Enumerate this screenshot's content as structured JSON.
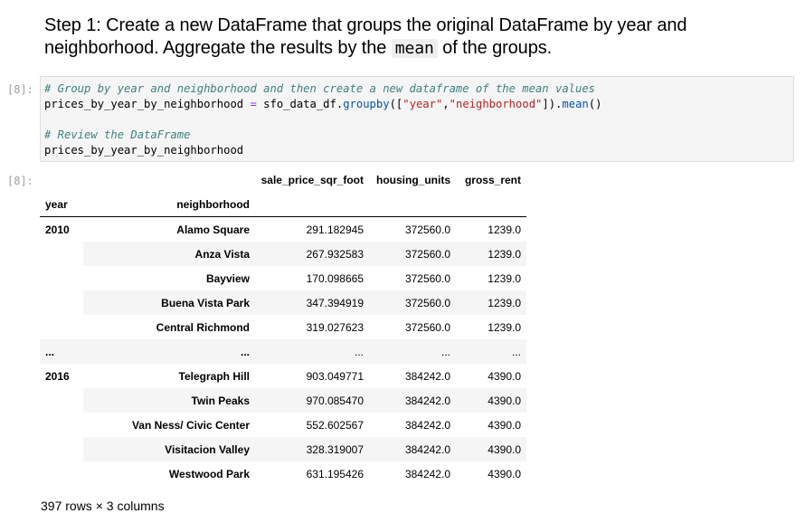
{
  "markdown": {
    "heading_part1": "Step 1: Create a new DataFrame that groups the original DataFrame by year and neighborhood. Aggregate the results by the ",
    "heading_code": "mean",
    "heading_part2": " of the groups."
  },
  "input_cell": {
    "prompt": "[8]:",
    "line1_comment": "# Group by year and neighborhood and then create a new dataframe of the mean values",
    "line2_var": "prices_by_year_by_neighborhood ",
    "line2_eq": "=",
    "line2_obj": " sfo_data_df.",
    "line2_method": "groupby",
    "line2_open": "([",
    "line2_str1": "\"year\"",
    "line2_comma": ",",
    "line2_str2": "\"neighborhood\"",
    "line2_close": "]).",
    "line2_method2": "mean",
    "line2_end": "()",
    "line4_comment": "# Review the DataFrame",
    "line5": "prices_by_year_by_neighborhood"
  },
  "output_cell": {
    "prompt": "[8]:",
    "columns": [
      "sale_price_sqr_foot",
      "housing_units",
      "gross_rent"
    ],
    "index_names": [
      "year",
      "neighborhood"
    ],
    "rows": [
      {
        "year": "2010",
        "neighborhood": "Alamo Square",
        "values": [
          "291.182945",
          "372560.0",
          "1239.0"
        ]
      },
      {
        "year": "",
        "neighborhood": "Anza Vista",
        "values": [
          "267.932583",
          "372560.0",
          "1239.0"
        ]
      },
      {
        "year": "",
        "neighborhood": "Bayview",
        "values": [
          "170.098665",
          "372560.0",
          "1239.0"
        ]
      },
      {
        "year": "",
        "neighborhood": "Buena Vista Park",
        "values": [
          "347.394919",
          "372560.0",
          "1239.0"
        ]
      },
      {
        "year": "",
        "neighborhood": "Central Richmond",
        "values": [
          "319.027623",
          "372560.0",
          "1239.0"
        ]
      },
      {
        "year": "...",
        "neighborhood": "...",
        "values": [
          "...",
          "...",
          "..."
        ]
      },
      {
        "year": "2016",
        "neighborhood": "Telegraph Hill",
        "values": [
          "903.049771",
          "384242.0",
          "4390.0"
        ]
      },
      {
        "year": "",
        "neighborhood": "Twin Peaks",
        "values": [
          "970.085470",
          "384242.0",
          "4390.0"
        ]
      },
      {
        "year": "",
        "neighborhood": "Van Ness/ Civic Center",
        "values": [
          "552.602567",
          "384242.0",
          "4390.0"
        ]
      },
      {
        "year": "",
        "neighborhood": "Visitacion Valley",
        "values": [
          "328.319007",
          "384242.0",
          "4390.0"
        ]
      },
      {
        "year": "",
        "neighborhood": "Westwood Park",
        "values": [
          "631.195426",
          "384242.0",
          "4390.0"
        ]
      }
    ],
    "shape_note": "397 rows × 3 columns"
  }
}
